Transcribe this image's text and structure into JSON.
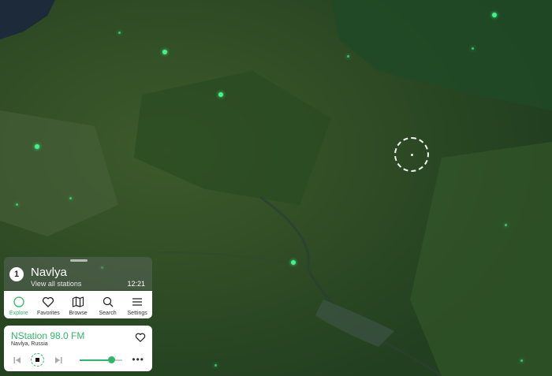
{
  "location": {
    "index": "1",
    "name": "Navlya",
    "subtitle": "View all stations",
    "time": "12:21"
  },
  "nav": {
    "items": [
      {
        "label": "Explore",
        "icon": "explore-icon",
        "active": true
      },
      {
        "label": "Favorites",
        "icon": "heart-icon",
        "active": false
      },
      {
        "label": "Browse",
        "icon": "map-icon",
        "active": false
      },
      {
        "label": "Search",
        "icon": "search-icon",
        "active": false
      },
      {
        "label": "Settings",
        "icon": "menu-icon",
        "active": false
      }
    ]
  },
  "player": {
    "station": "NStation 98.0 FM",
    "location": "Navlya, Russia",
    "volume": 0.75,
    "more": "•••"
  },
  "colors": {
    "accent": "#2fb86a",
    "station_dot": "#3ff58a"
  }
}
